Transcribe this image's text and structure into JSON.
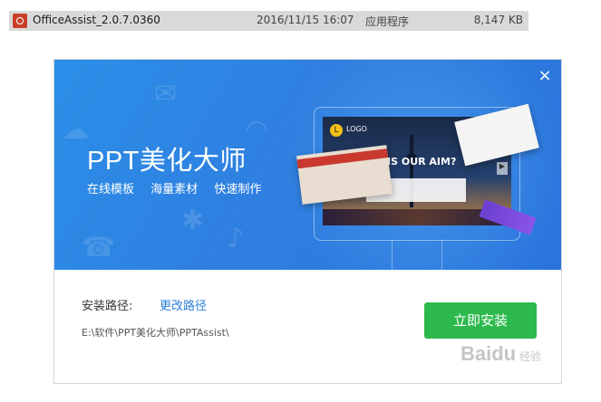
{
  "explorer_row": {
    "name": "OfficeAssist_2.0.7.0360",
    "date": "2016/11/15 16:07",
    "type": "应用程序",
    "size": "8,147 KB"
  },
  "installer": {
    "close_glyph": "×",
    "app_title": "PPT美化大师",
    "features": [
      "在线模板",
      "海量素材",
      "快速制作"
    ],
    "preview": {
      "logo_badge": "L",
      "logo_text": "LOGO",
      "headline": "AT IS OUR  AIM?"
    },
    "path_label": "安装路径:",
    "change_path": "更改路径",
    "install_path": "E:\\软件\\PPT美化大师\\PPTAssist\\",
    "install_button": "立即安装"
  },
  "watermark": {
    "text": "Baidu",
    "sub": "经验"
  },
  "colors": {
    "banner_blue": "#2f7fe0",
    "install_green": "#2db94d",
    "link_blue": "#2b7fd8"
  }
}
